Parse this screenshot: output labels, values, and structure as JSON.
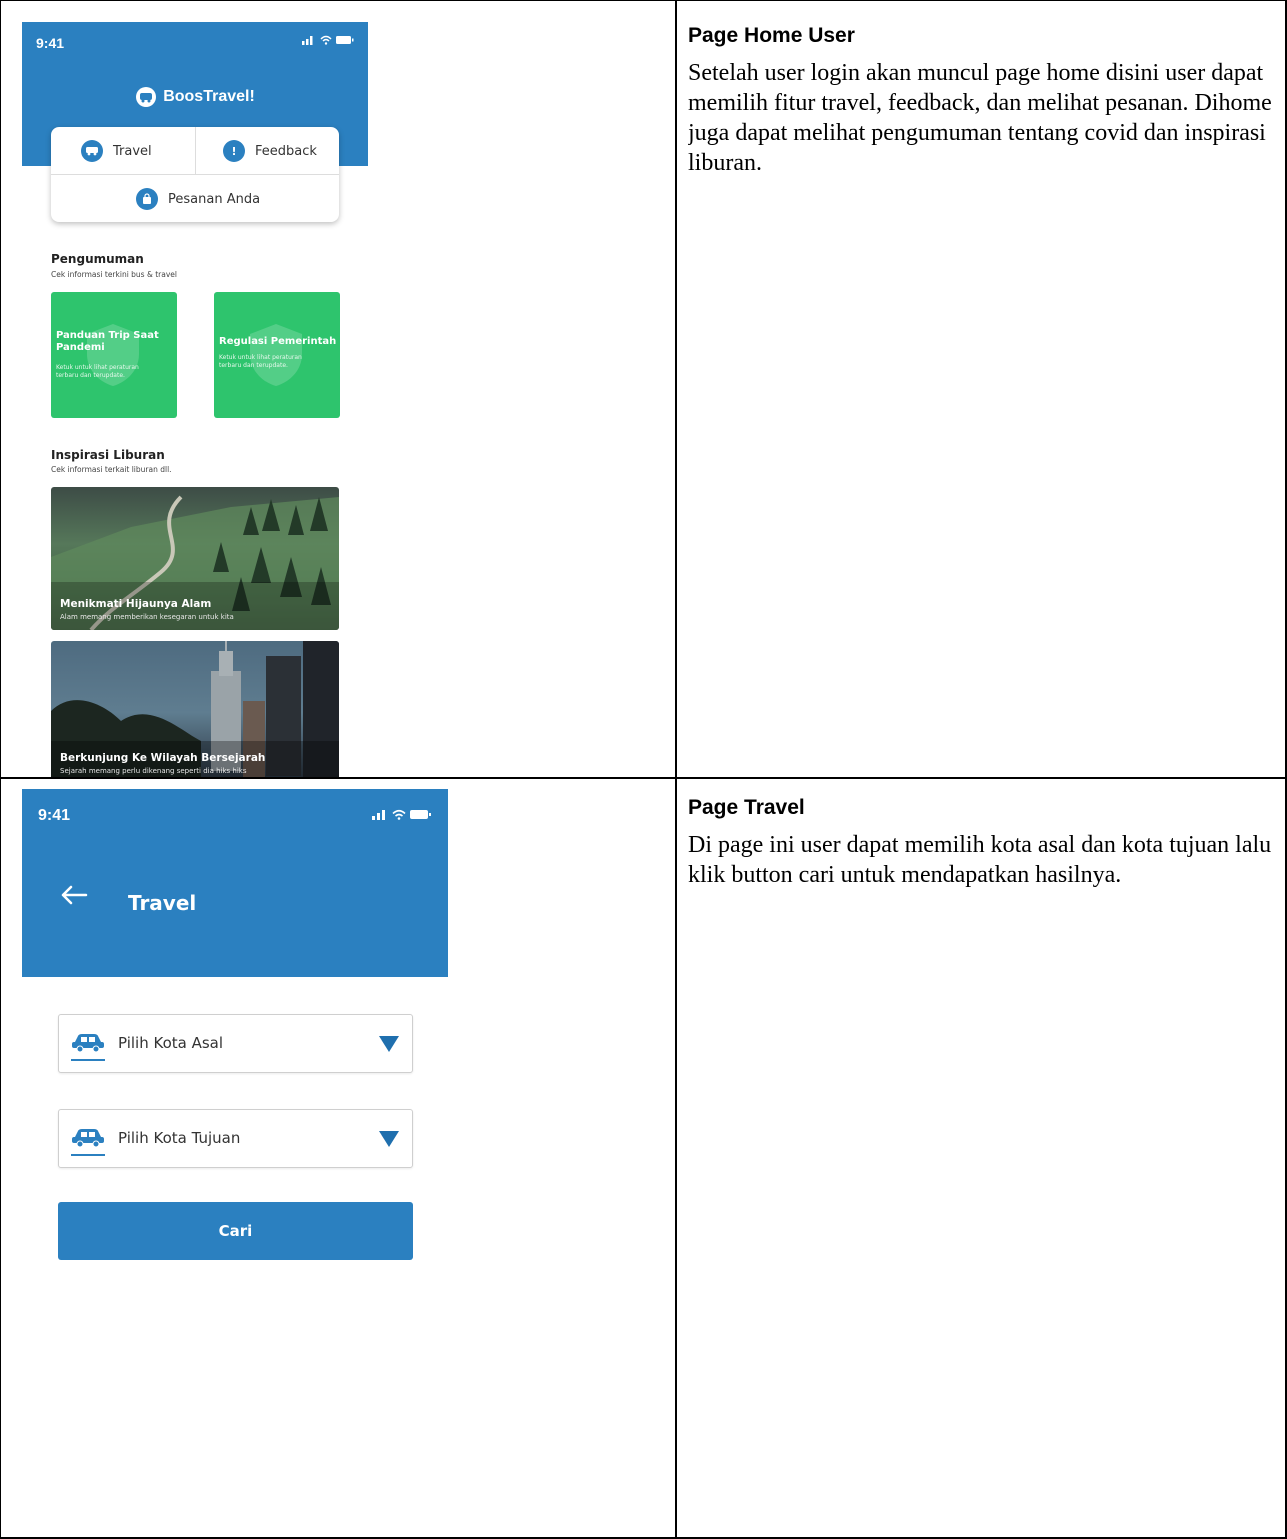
{
  "home_section": {
    "heading": "Page Home User",
    "description": "Setelah user login akan muncul page home disini user dapat memilih fitur travel, feedback, dan melihat pesanan. Dihome juga dapat melihat pengumuman tentang covid dan inspirasi liburan."
  },
  "travel_section": {
    "heading": "Page Travel",
    "description": "Di page ini user dapat memilih kota asal dan kota tujuan lalu klik button cari untuk mendapatkan hasilnya."
  },
  "home_phone": {
    "status_time": "9:41",
    "brand": "BoosTravel!",
    "menu": {
      "travel": "Travel",
      "feedback": "Feedback",
      "orders": "Pesanan Anda"
    },
    "announcements": {
      "title": "Pengumuman",
      "subtitle": "Cek informasi terkini bus & travel",
      "cards": [
        {
          "title": "Panduan Trip Saat Pandemi",
          "desc": "Ketuk untuk lihat peraturan terbaru dan terupdate."
        },
        {
          "title": "Regulasi Pemerintah",
          "desc": "Ketuk untuk lihat peraturan terbaru dan terupdate."
        }
      ]
    },
    "inspiration": {
      "title": "Inspirasi Liburan",
      "subtitle": "Cek informasi terkait liburan dll.",
      "cards": [
        {
          "title": "Menikmati Hijaunya Alam",
          "desc": "Alam memang memberikan kesegaran untuk kita"
        },
        {
          "title": "Berkunjung Ke Wilayah Bersejarah",
          "desc": "Sejarah memang perlu dikenang seperti dia hiks hiks"
        }
      ]
    }
  },
  "travel_phone": {
    "status_time": "9:41",
    "title": "Travel",
    "origin_placeholder": "Pilih Kota Asal",
    "destination_placeholder": "Pilih Kota Tujuan",
    "search_label": "Cari"
  },
  "colors": {
    "primary": "#2b80c0",
    "announcement_green": "#2ec46d"
  }
}
